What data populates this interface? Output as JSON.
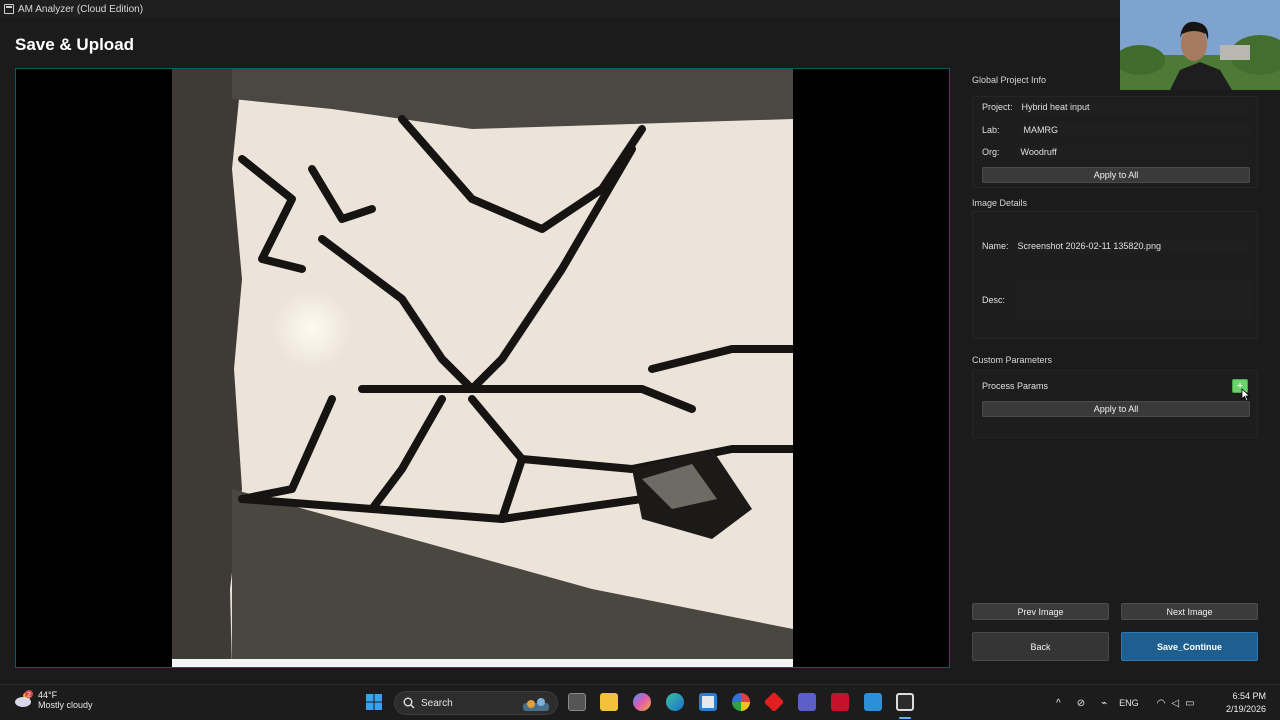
{
  "window": {
    "title": "AM Analyzer (Cloud Edition)"
  },
  "page": {
    "title": "Save & Upload"
  },
  "global_project": {
    "section_title": "Global Project Info",
    "project_label": "Project:",
    "project_value": "Hybrid heat input",
    "lab_label": "Lab:",
    "lab_value": "MAMRG",
    "org_label": "Org:",
    "org_value": "Woodruff",
    "apply_label": "Apply to All"
  },
  "image_details": {
    "section_title": "Image Details",
    "name_label": "Name:",
    "name_value": "Screenshot 2026-02-11 135820.png",
    "desc_label": "Desc:",
    "desc_value": ""
  },
  "custom_params": {
    "section_title": "Custom Parameters",
    "process_label": "Process Params",
    "add_symbol": "+",
    "apply_label": "Apply to All"
  },
  "navigation": {
    "prev_label": "Prev Image",
    "next_label": "Next Image",
    "back_label": "Back",
    "save_label": "Save_Continue"
  },
  "taskbar": {
    "weather_temp": "44°F",
    "weather_desc": "Mostly cloudy",
    "weather_badge": "2",
    "search_label": "Search",
    "language": "ENG",
    "time": "6:54 PM",
    "date": "2/19/2026"
  },
  "colors": {
    "accent": "#1f5f8f",
    "plus_button": "#6bd36b",
    "viewer_border": "#0f5a66"
  }
}
